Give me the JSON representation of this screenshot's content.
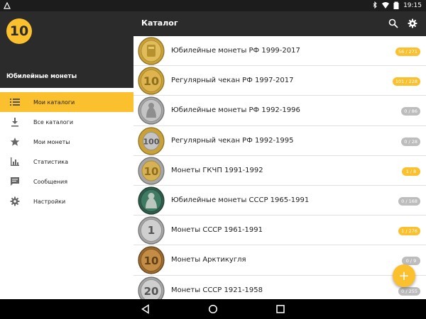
{
  "status_bar": {
    "time": "19:15",
    "icons": [
      "notification-icon",
      "bluetooth-icon",
      "wifi-icon",
      "battery-icon"
    ]
  },
  "drawer": {
    "logo_text": "10",
    "title": "Юбилейные монеты",
    "items": [
      {
        "label": "Мои каталоги",
        "icon": "list-icon",
        "active": true
      },
      {
        "label": "Все каталоги",
        "icon": "download-icon",
        "active": false
      },
      {
        "label": "Мои монеты",
        "icon": "star-icon",
        "active": false
      },
      {
        "label": "Статистика",
        "icon": "chart-icon",
        "active": false
      },
      {
        "label": "Сообщения",
        "icon": "message-icon",
        "active": false
      },
      {
        "label": "Настройки",
        "icon": "gear-icon",
        "active": false
      }
    ]
  },
  "appbar": {
    "title": "Каталог",
    "icons": [
      "search-icon",
      "settings-icon"
    ]
  },
  "catalogs": [
    {
      "name": "Юбилейные монеты РФ 1999-2017",
      "badge": "56 / 271",
      "badge_color": "yellow",
      "coin": "gold",
      "coin_text": ""
    },
    {
      "name": "Регулярный чекан РФ 1997-2017",
      "badge": "101 / 228",
      "badge_color": "yellow",
      "coin": "gold",
      "coin_text": "10"
    },
    {
      "name": "Юбилейные монеты РФ 1992-1996",
      "badge": "0 / 86",
      "badge_color": "gray",
      "coin": "silver",
      "coin_text": ""
    },
    {
      "name": "Регулярный чекан РФ 1992-1995",
      "badge": "0 / 28",
      "badge_color": "gray",
      "coin": "bimetal",
      "coin_text": "100"
    },
    {
      "name": "Монеты ГКЧП 1991-1992",
      "badge": "1 / 8",
      "badge_color": "yellow",
      "coin": "bimetal",
      "coin_text": "10"
    },
    {
      "name": "Юбилейные монеты СССР 1965-1991",
      "badge": "0 / 168",
      "badge_color": "gray",
      "coin": "green",
      "coin_text": ""
    },
    {
      "name": "Монеты СССР 1961-1991",
      "badge": "1 / 276",
      "badge_color": "yellow",
      "coin": "silver",
      "coin_text": "1"
    },
    {
      "name": "Монеты Арктикугля",
      "badge": "0 / 9",
      "badge_color": "gray",
      "coin": "bronze",
      "coin_text": "10"
    },
    {
      "name": "Монеты СССР 1921-1958",
      "badge": "0 / 255",
      "badge_color": "gray",
      "coin": "silver",
      "coin_text": "20"
    }
  ],
  "fab": {
    "label": "+"
  },
  "navbar": {
    "icons": [
      "back-icon",
      "home-icon",
      "recents-icon"
    ]
  },
  "colors": {
    "accent": "#fbc02d",
    "dark": "#2b2b2b",
    "badge_gray": "#bdbdbd"
  }
}
